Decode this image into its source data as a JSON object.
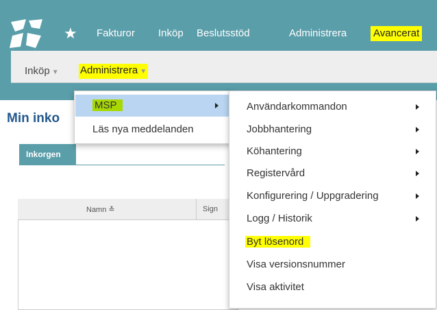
{
  "top_nav": {
    "items": [
      {
        "label": "Fakturor"
      },
      {
        "label": "Inköp"
      },
      {
        "label": "Beslutsstöd"
      },
      {
        "label": "Administrera"
      },
      {
        "label": "Avancerat"
      }
    ]
  },
  "sub_nav": {
    "items": [
      {
        "label": "Inköp"
      },
      {
        "label": "Administrera"
      }
    ]
  },
  "page": {
    "title": "Min inko",
    "tab_label": "Inkorgen",
    "columns": [
      {
        "label": "Namn ≛"
      },
      {
        "label": "Sign"
      }
    ]
  },
  "menu_administrera": {
    "items": [
      {
        "label": "MSP"
      },
      {
        "label": "Läs nya meddelanden"
      }
    ]
  },
  "menu_msp": {
    "items": [
      {
        "label": "Användarkommandon"
      },
      {
        "label": "Jobbhantering"
      },
      {
        "label": "Köhantering"
      },
      {
        "label": "Registervård"
      },
      {
        "label": "Konfigurering / Uppgradering"
      },
      {
        "label": "Logg / Historik"
      },
      {
        "label": "Byt lösenord"
      },
      {
        "label": "Visa versionsnummer"
      },
      {
        "label": "Visa aktivitet"
      }
    ]
  },
  "colors": {
    "brand": "#5a9eaa",
    "highlight": "#ffff00",
    "highlight_green": "#a8d800",
    "menu_active": "#b9d5f1"
  },
  "icons": {
    "logo": "brand-logo-icon",
    "favorites": "star-icon",
    "submenu": "chevron-right-icon",
    "dropdown": "caret-down-icon"
  }
}
